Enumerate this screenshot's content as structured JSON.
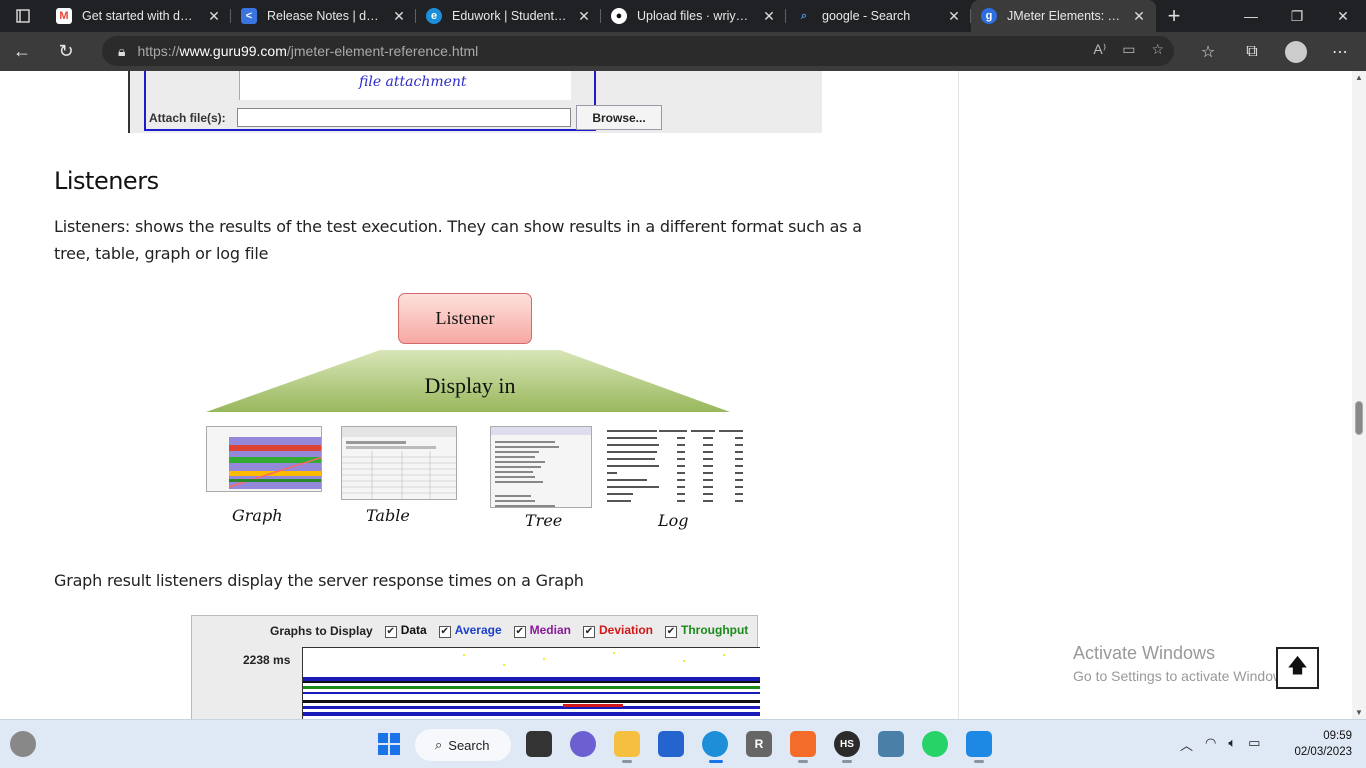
{
  "browser": {
    "tabs": [
      {
        "title": "Get started with dbdiagram",
        "favicon": "gmail-icon",
        "color": "#ea4335"
      },
      {
        "title": "Release Notes | dbdiagram",
        "favicon": "share-icon",
        "color": "#3b73e0"
      },
      {
        "title": "Eduwork | Student Dashboard",
        "favicon": "edge-icon",
        "color": "#1d8fd8"
      },
      {
        "title": "Upload files · wriyant/l",
        "favicon": "github-icon",
        "color": "#ffffff"
      },
      {
        "title": "google - Search",
        "favicon": "search-icon",
        "color": "#4a90e2"
      },
      {
        "title": "JMeter Elements: Thread",
        "favicon": "guru99-icon",
        "color": "#2d6fe0"
      }
    ],
    "url_prefix": "https://",
    "url_domain": "www.guru99.com",
    "url_path": "/jmeter-element-reference.html"
  },
  "page": {
    "attach_handwriting": "file attachment",
    "attach_label": "Attach file(s):",
    "browse_label": "Browse...",
    "heading": "Listeners",
    "intro": "Listeners: shows the results of the test execution. They can show results in a different format such as a tree, table, graph or log file",
    "diagram": {
      "top_box": "Listener",
      "middle": "Display in",
      "labels": [
        "Graph",
        "Table",
        "Tree",
        "Log"
      ]
    },
    "graph_text": "Graph result listeners display the server response times on a Graph",
    "graph_shot": {
      "graphs_to_display": "Graphs to Display",
      "options": [
        {
          "label": "Data",
          "color": "#111111"
        },
        {
          "label": "Average",
          "color": "#1a3fcc"
        },
        {
          "label": "Median",
          "color": "#8a1a9a"
        },
        {
          "label": "Deviation",
          "color": "#d01818"
        },
        {
          "label": "Throughput",
          "color": "#1a8a1a"
        }
      ],
      "ms_label": "2238 ms"
    }
  },
  "overlay": {
    "activate_title": "Activate Windows",
    "activate_sub": "Go to Settings to activate Windows."
  },
  "taskbar": {
    "search_label": "Search",
    "time": "09:59",
    "date": "02/03/2023"
  }
}
